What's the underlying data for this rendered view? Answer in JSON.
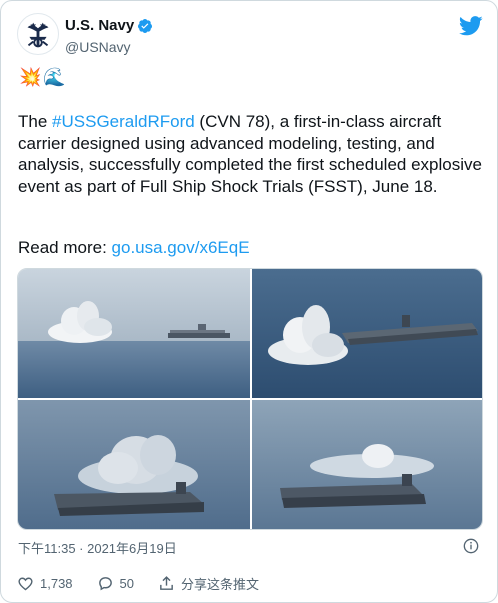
{
  "author": {
    "name": "U.S. Navy",
    "handle": "@USNavy"
  },
  "tweet": {
    "emojis": "💥🌊",
    "text_parts": {
      "p1": "The ",
      "hashtag": "#USSGeraldRFord",
      "p2": " (CVN 78), a first-in-class aircraft carrier designed using advanced modeling, testing, and analysis, successfully completed the first scheduled explosive event as part of Full Ship Shock Trials (FSST), June 18."
    },
    "read_more_label": "Read more: ",
    "link": "go.usa.gov/x6EqE"
  },
  "timestamp": "下午11:35 · 2021年6月19日",
  "actions": {
    "likes": "1,738",
    "replies": "50",
    "share_label": "分享这条推文"
  },
  "colors": {
    "link": "#1d9bf0",
    "text": "#0f1419",
    "muted": "#536471",
    "border": "#cfd9de"
  },
  "icons": [
    "navy-seal-icon",
    "verified-badge-icon",
    "twitter-bird-icon",
    "info-icon",
    "heart-icon",
    "reply-icon",
    "share-icon"
  ]
}
